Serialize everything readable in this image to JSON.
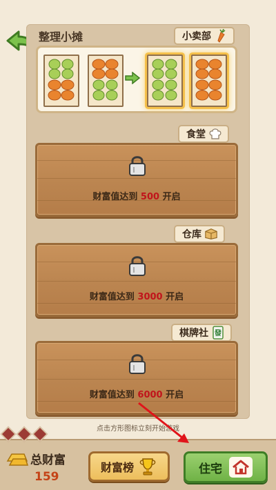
{
  "header": {
    "title": "整理小摊",
    "back_icon": "back-arrow-icon"
  },
  "sections": {
    "snack_stall": {
      "label": "小卖部",
      "icon": "carrot-icon"
    },
    "canteen": {
      "label": "食堂",
      "icon": "chef-hat-icon",
      "unlock_prefix": "财富值达到",
      "unlock_value": "500",
      "unlock_suffix": "开启"
    },
    "warehouse": {
      "label": "仓库",
      "icon": "box-icon",
      "unlock_prefix": "财富值达到",
      "unlock_value": "3000",
      "unlock_suffix": "开启"
    },
    "chess_room": {
      "label": "棋牌社",
      "icon": "mahjong-icon",
      "unlock_prefix": "财富值达到",
      "unlock_value": "6000",
      "unlock_suffix": "开启"
    }
  },
  "hint": "点击方形图标立刻开始游戏",
  "footer": {
    "wealth_label": "总财富",
    "wealth_value": "159",
    "rank_button": "财富榜",
    "home_button": "住宅"
  },
  "colors": {
    "locked_value": "#c0141b",
    "wealth_value": "#c44317",
    "home_button": "#6fb246",
    "rank_button": "#edbe5c"
  }
}
